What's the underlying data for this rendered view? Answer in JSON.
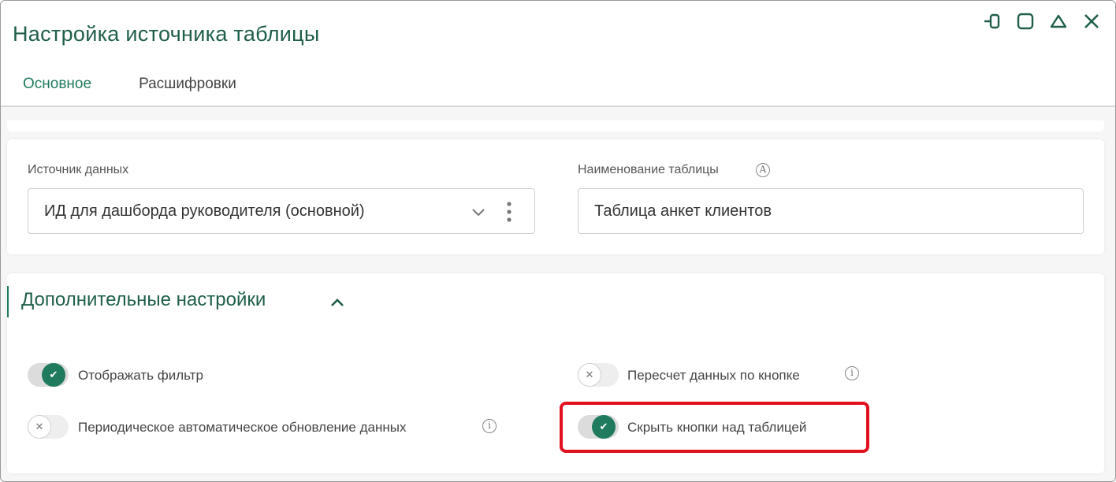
{
  "window": {
    "title": "Настройка источника таблицы",
    "controls": [
      "pin-icon",
      "maximize-icon",
      "collapse-icon",
      "close-icon"
    ]
  },
  "tabs": [
    {
      "label": "Основное",
      "active": true
    },
    {
      "label": "Расшифровки",
      "active": false
    }
  ],
  "source": {
    "label": "Источник данных",
    "value": "ИД для дашборда руководителя (основной)"
  },
  "table_name": {
    "label": "Наименование таблицы",
    "info_glyph": "A",
    "value": "Таблица анкет клиентов"
  },
  "advanced": {
    "title": "Дополнительные настройки",
    "options": {
      "show_filter": {
        "label": "Отображать фильтр",
        "enabled": true
      },
      "auto_refresh": {
        "label": "Периодическое автоматическое обновление данных",
        "enabled": false
      },
      "recalc_button": {
        "label": "Пересчет данных по кнопке",
        "enabled": false
      },
      "hide_buttons": {
        "label": "Скрыть кнопки над таблицей",
        "enabled": true
      }
    }
  },
  "colors": {
    "accent": "#1f7a5e",
    "title": "#1f5e4b",
    "highlight": "#e0101f"
  },
  "glyphs": {
    "check": "✔",
    "cross": "✕",
    "info": "i"
  }
}
